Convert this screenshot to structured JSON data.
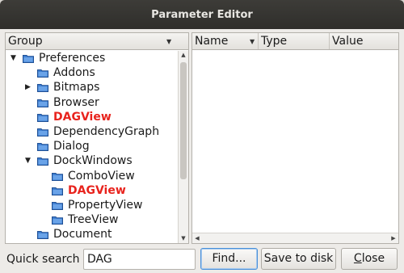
{
  "window": {
    "title": "Parameter Editor"
  },
  "group_tree": {
    "header": "Group",
    "items": [
      {
        "label": "Preferences",
        "level": 0,
        "expander": "open",
        "highlight": false,
        "icon": "folder-icon"
      },
      {
        "label": "Addons",
        "level": 1,
        "expander": "none",
        "highlight": false,
        "icon": "folder-icon"
      },
      {
        "label": "Bitmaps",
        "level": 1,
        "expander": "closed",
        "highlight": false,
        "icon": "folder-icon"
      },
      {
        "label": "Browser",
        "level": 1,
        "expander": "none",
        "highlight": false,
        "icon": "folder-icon"
      },
      {
        "label": "DAGView",
        "level": 1,
        "expander": "none",
        "highlight": true,
        "icon": "folder-icon"
      },
      {
        "label": "DependencyGraph",
        "level": 1,
        "expander": "none",
        "highlight": false,
        "icon": "folder-icon"
      },
      {
        "label": "Dialog",
        "level": 1,
        "expander": "none",
        "highlight": false,
        "icon": "folder-icon"
      },
      {
        "label": "DockWindows",
        "level": 1,
        "expander": "open",
        "highlight": false,
        "icon": "folder-icon"
      },
      {
        "label": "ComboView",
        "level": 2,
        "expander": "none",
        "highlight": false,
        "icon": "folder-icon"
      },
      {
        "label": "DAGView",
        "level": 2,
        "expander": "none",
        "highlight": true,
        "icon": "folder-icon"
      },
      {
        "label": "PropertyView",
        "level": 2,
        "expander": "none",
        "highlight": false,
        "icon": "folder-icon"
      },
      {
        "label": "TreeView",
        "level": 2,
        "expander": "none",
        "highlight": false,
        "icon": "folder-icon"
      },
      {
        "label": "Document",
        "level": 1,
        "expander": "none",
        "highlight": false,
        "icon": "folder-icon"
      }
    ]
  },
  "param_table": {
    "columns": [
      "Name",
      "Type",
      "Value"
    ],
    "rows": []
  },
  "bottom_bar": {
    "quick_search_label": "Quick search",
    "quick_search_value": "DAG",
    "find_label": "Find...",
    "save_label": "Save to disk",
    "close_label": "Close"
  },
  "colors": {
    "highlight_text": "#e8231d",
    "folder_blue": "#3f7fd1",
    "focus_border": "#4a90d9"
  }
}
